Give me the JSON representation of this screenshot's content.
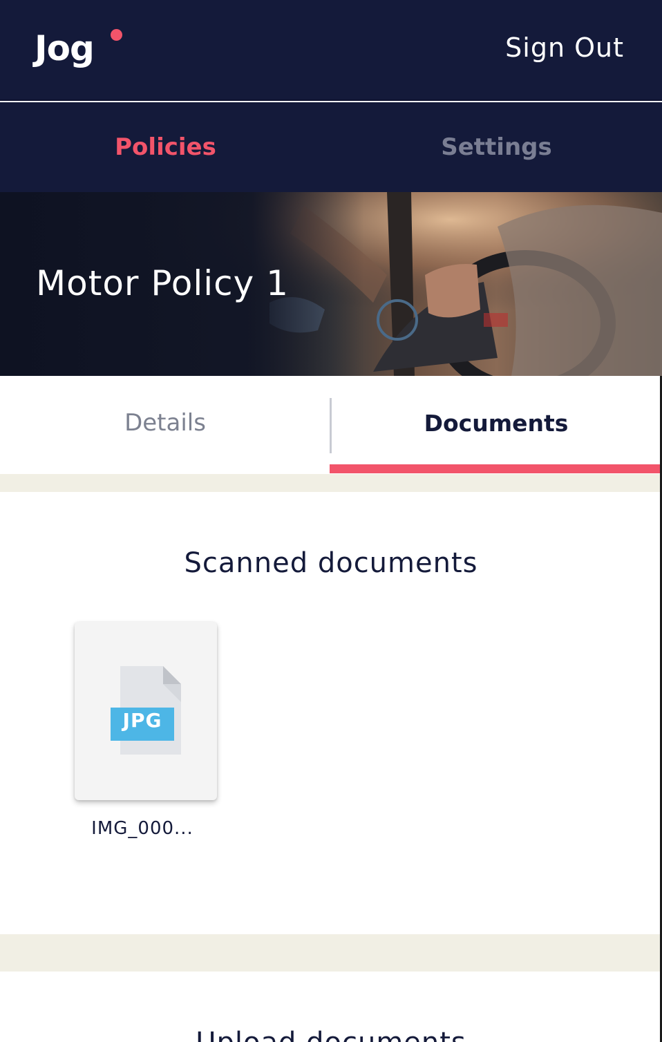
{
  "header": {
    "logo_text": "Jog",
    "sign_out_label": "Sign Out"
  },
  "nav": {
    "tabs": [
      {
        "label": "Policies",
        "active": true
      },
      {
        "label": "Settings",
        "active": false
      }
    ]
  },
  "hero": {
    "title": "Motor Policy 1"
  },
  "subtabs": {
    "items": [
      {
        "label": "Details",
        "active": false
      },
      {
        "label": "Documents",
        "active": true
      }
    ]
  },
  "scanned_documents": {
    "title": "Scanned documents",
    "files": [
      {
        "type_label": "JPG",
        "name": "IMG_000..."
      }
    ]
  },
  "upload_documents": {
    "title": "Upload documents"
  },
  "colors": {
    "navy": "#141a3a",
    "accent": "#f2546a",
    "muted": "#7a7e93",
    "band": "#f1efe4",
    "jpg_badge": "#4db6e6"
  }
}
